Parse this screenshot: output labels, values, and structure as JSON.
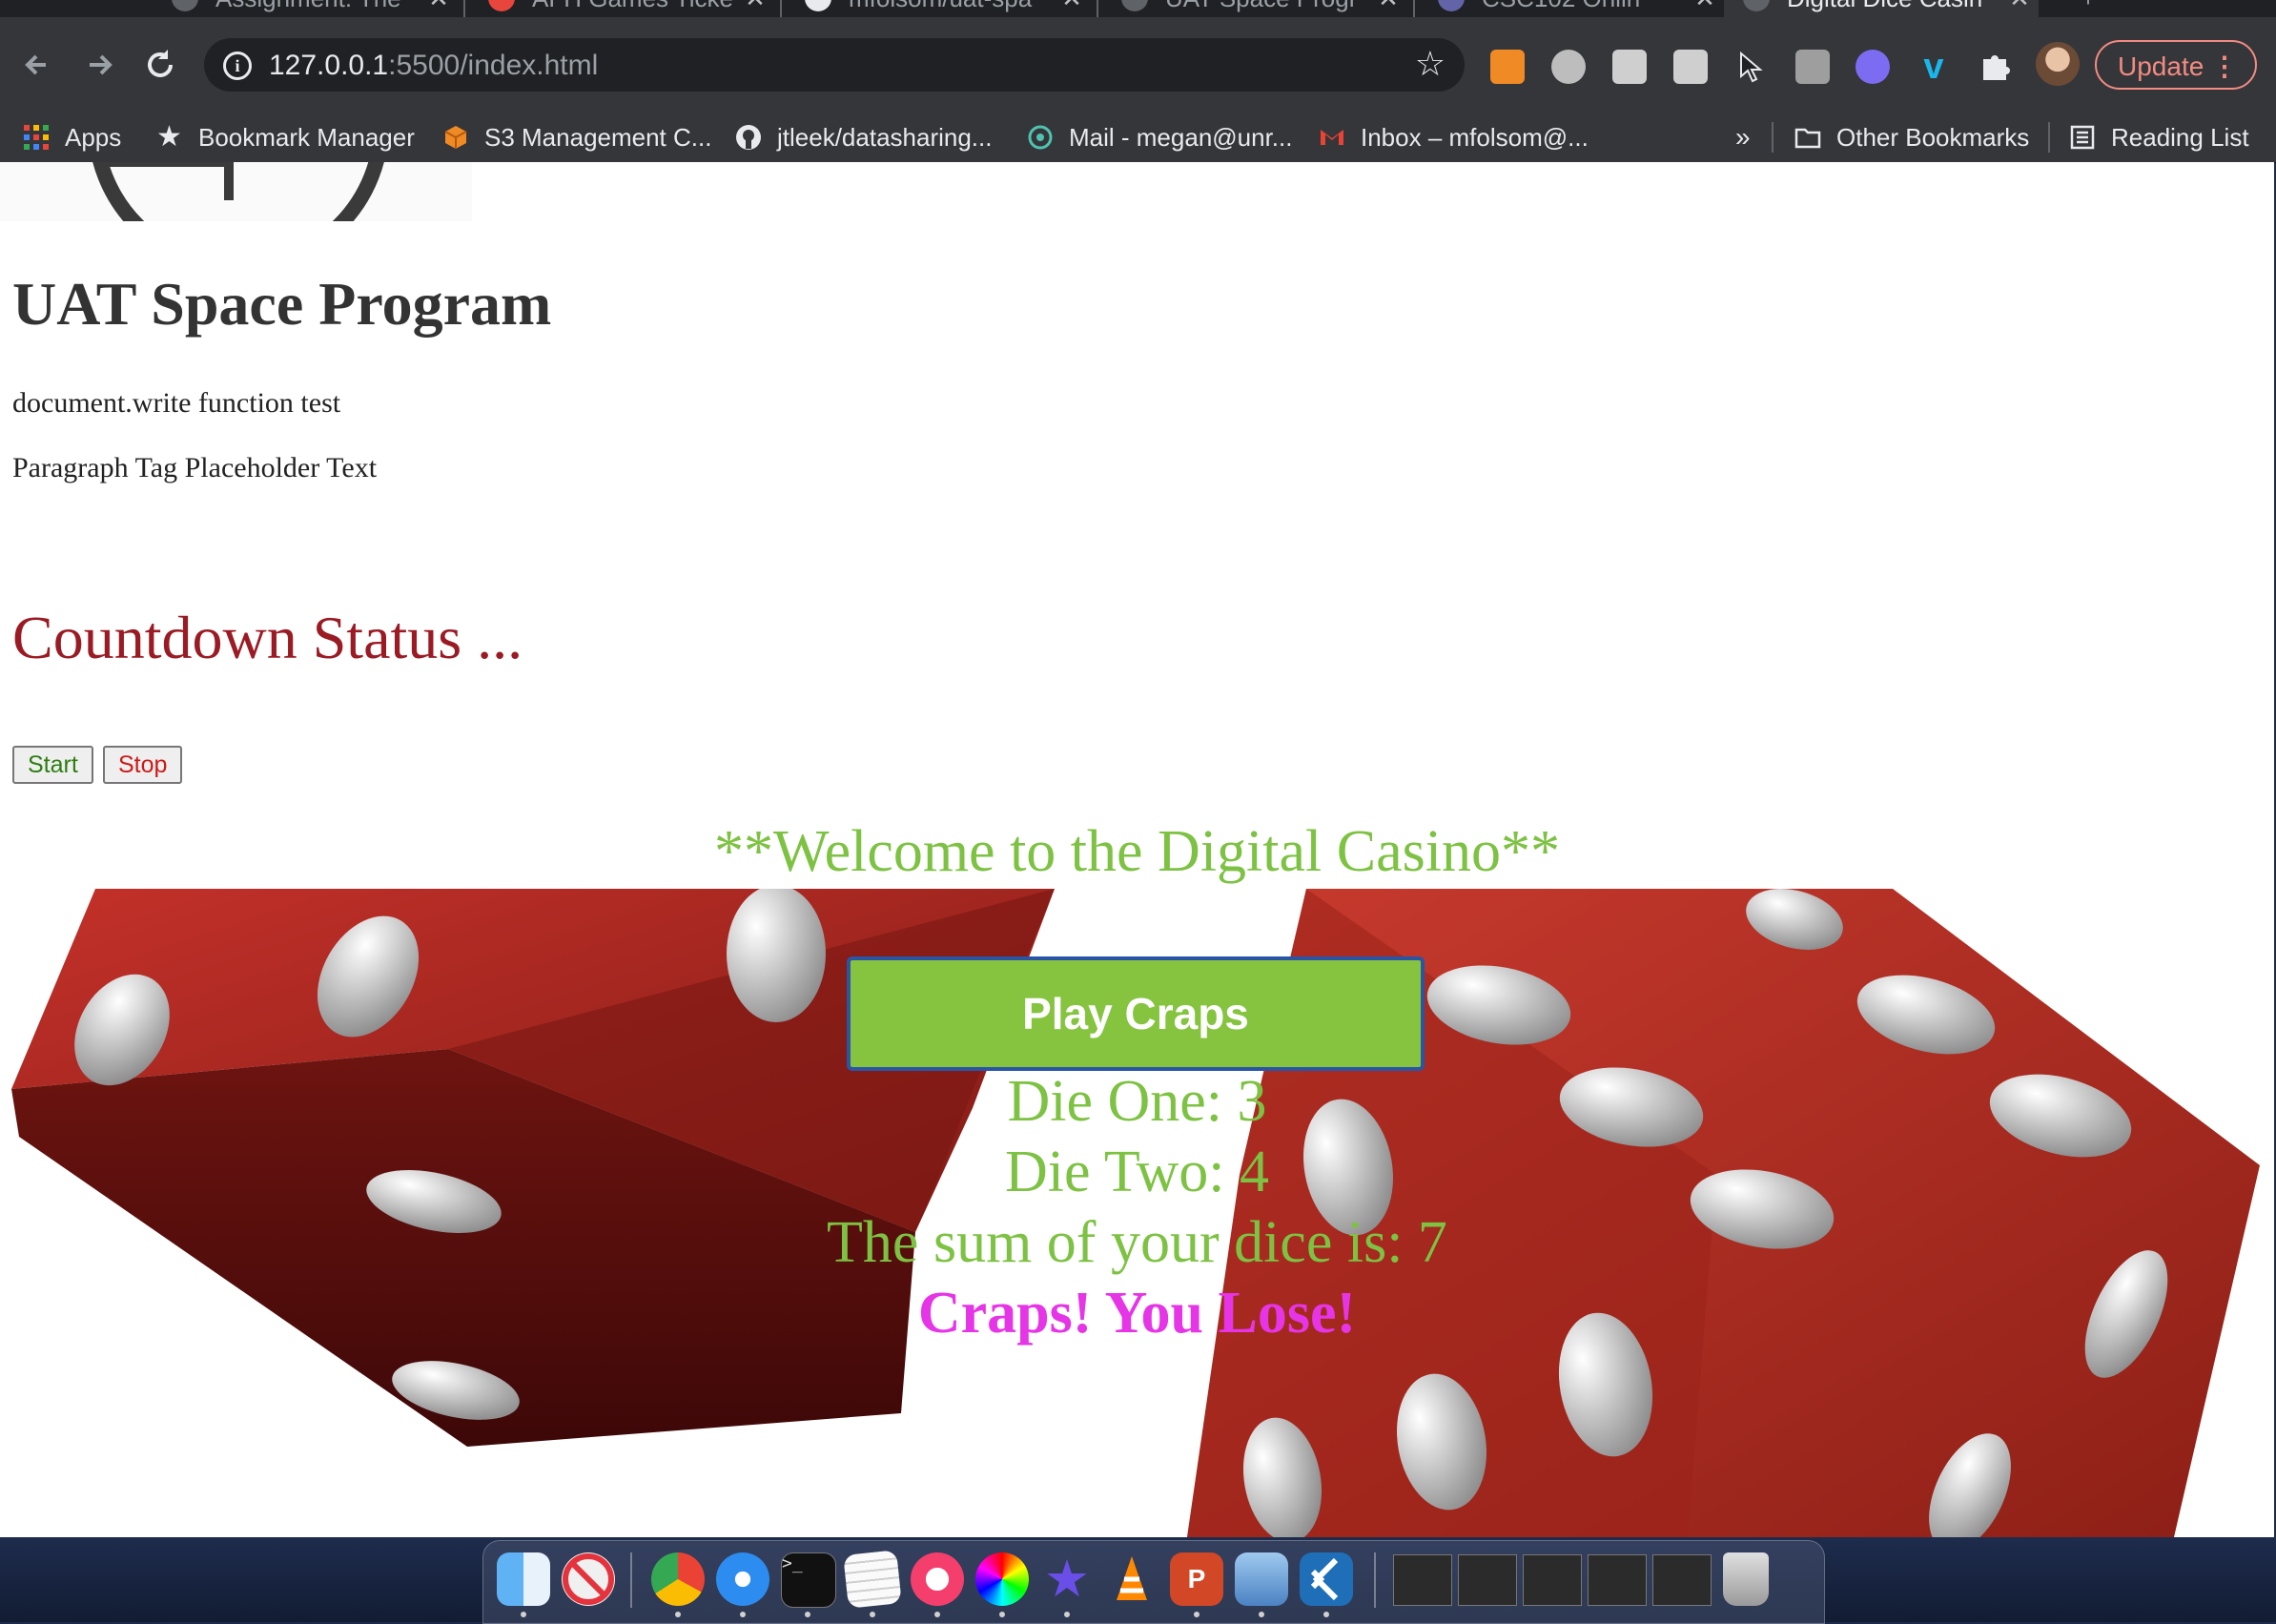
{
  "browser": {
    "tabs": [
      {
        "title": "Assignment: The",
        "active": false
      },
      {
        "title": "AFH Games Ticke",
        "active": false
      },
      {
        "title": "mfolsom/uat-spa",
        "active": false
      },
      {
        "title": "UAT Space Progr",
        "active": false
      },
      {
        "title": "CSC102 Onlin",
        "active": false
      },
      {
        "title": "Digital Dice Casin",
        "active": true
      }
    ],
    "url": {
      "host": "127.0.0.1",
      "path": ":5500/index.html"
    },
    "update_label": "Update",
    "bookmarks": [
      {
        "label": "Apps",
        "icon": "apps-grid-icon",
        "color": "#e8453c"
      },
      {
        "label": "Bookmark Manager",
        "icon": "star-icon",
        "color": "#e8eaed"
      },
      {
        "label": "S3 Management C...",
        "icon": "aws-cube-icon",
        "color": "#f08a24"
      },
      {
        "label": "jtleek/datasharing...",
        "icon": "github-icon",
        "color": "#e8eaed"
      },
      {
        "label": "Mail - megan@unr...",
        "icon": "mail-swirl-icon",
        "color": "#4fc3b0"
      },
      {
        "label": "Inbox – mfolsom@...",
        "icon": "gmail-icon",
        "color": "#ea4335"
      }
    ],
    "bookmarks_overflow": "»",
    "other_bookmarks_label": "Other Bookmarks",
    "reading_list_label": "Reading List"
  },
  "page": {
    "heading": "UAT Space Program",
    "doc_write_text": "document.write function test",
    "paragraph_text": "Paragraph Tag Placeholder Text",
    "countdown_status": "Countdown Status ...",
    "start_label": "Start",
    "stop_label": "Stop",
    "welcome": "**Welcome to the Digital Casino**",
    "play_label": "Play Craps",
    "die_one": "Die One: 3",
    "die_two": "Die Two: 4",
    "sum": "The sum of your dice is: 7",
    "outcome": "Craps! You Lose!",
    "colors": {
      "welcome_green": "#7dc242",
      "button_green": "#86c440",
      "outcome_magenta": "#e535e6",
      "countdown_red": "#9b1b24",
      "dice_red": "#c42a22"
    }
  },
  "dock": {
    "apps": [
      "Finder",
      "News",
      "Chrome",
      "Safari",
      "Terminal",
      "TextEdit",
      "Music",
      "Color Picker",
      "iMovie",
      "VLC",
      "PowerPoint",
      "Preview",
      "VS Code"
    ],
    "minimized_windows": 5,
    "trash": "Trash"
  }
}
